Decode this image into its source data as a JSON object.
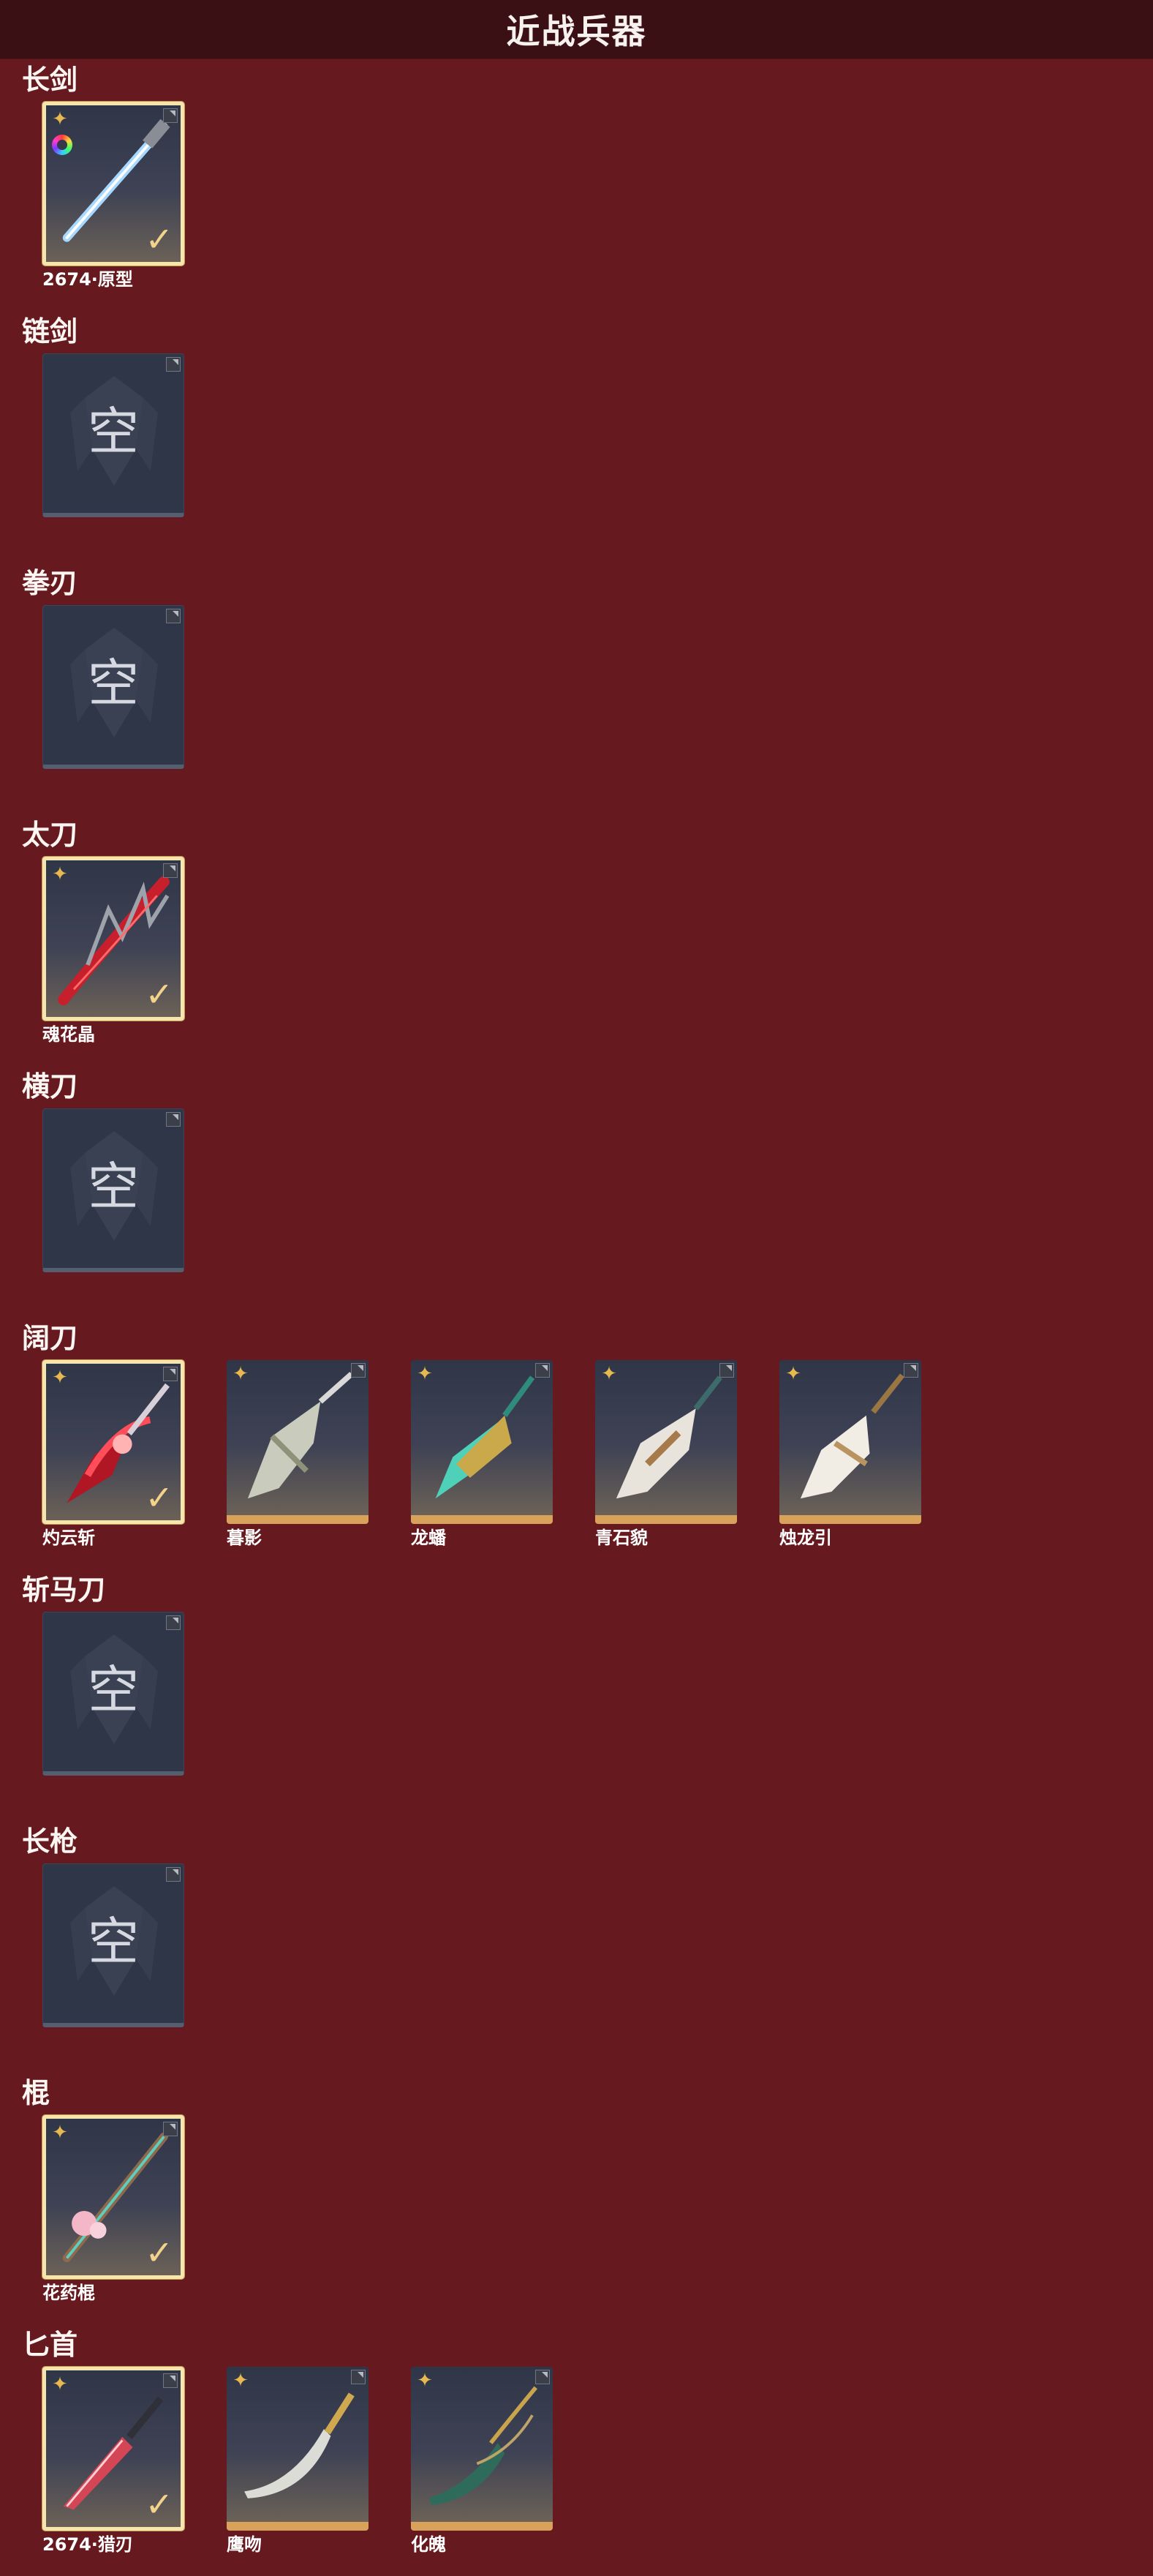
{
  "header": {
    "title": "近战兵器"
  },
  "empty_glyph": "空",
  "categories": [
    {
      "name": "长剑",
      "items": [
        {
          "name": "2674·原型",
          "selected": true,
          "variant": "rainbow",
          "icon": "long-sword-icon"
        }
      ]
    },
    {
      "name": "链剑",
      "items": []
    },
    {
      "name": "拳刃",
      "items": []
    },
    {
      "name": "太刀",
      "items": [
        {
          "name": "魂花晶",
          "selected": true,
          "icon": "katana-icon"
        }
      ]
    },
    {
      "name": "横刀",
      "items": []
    },
    {
      "name": "阔刀",
      "items": [
        {
          "name": "灼云斩",
          "selected": true,
          "icon": "broadsword-red-icon"
        },
        {
          "name": "暮影",
          "selected": false,
          "icon": "broadsword-silver-icon"
        },
        {
          "name": "龙蟠",
          "selected": false,
          "icon": "broadsword-jade-icon"
        },
        {
          "name": "青石貌",
          "selected": false,
          "icon": "broadsword-white-icon"
        },
        {
          "name": "烛龙引",
          "selected": false,
          "icon": "broadsword-bone-icon"
        }
      ]
    },
    {
      "name": "斩马刀",
      "items": []
    },
    {
      "name": "长枪",
      "items": []
    },
    {
      "name": "棍",
      "items": [
        {
          "name": "花药棍",
          "selected": true,
          "icon": "staff-icon"
        }
      ]
    },
    {
      "name": "匕首",
      "items": [
        {
          "name": "2674·猎刃",
          "selected": true,
          "icon": "dagger-red-icon"
        },
        {
          "name": "鹰吻",
          "selected": false,
          "icon": "dagger-curved-icon"
        },
        {
          "name": "化魄",
          "selected": false,
          "icon": "dagger-jade-icon"
        }
      ]
    }
  ],
  "colors": {
    "background": "#661a1f",
    "header": "#3a1014",
    "card_gold_border": "#d9a25b",
    "selected_border": "#f6e6ae",
    "star": "#e7b94f"
  }
}
